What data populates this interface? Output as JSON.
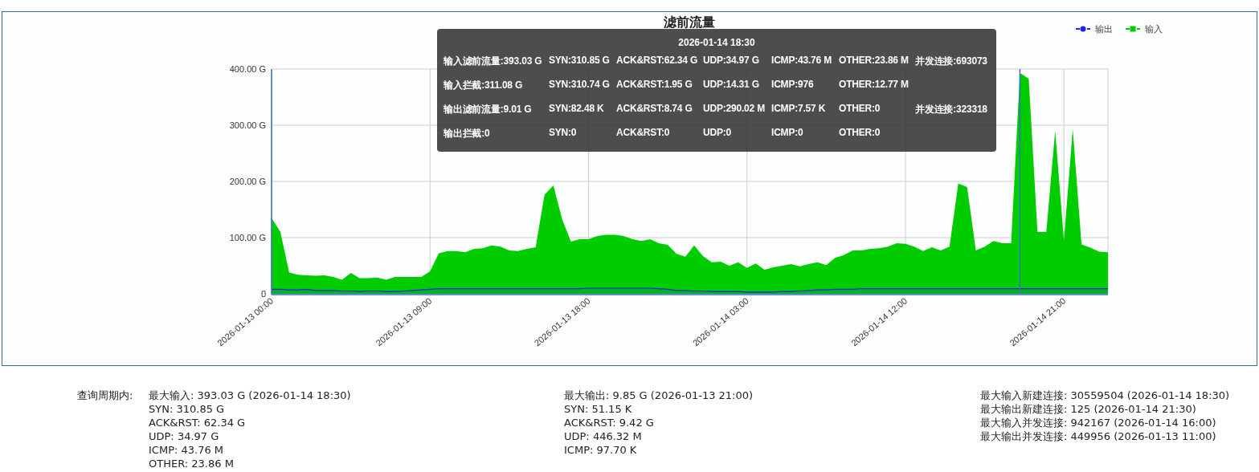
{
  "chart": {
    "chart_data": {
      "type": "area",
      "title": "滤前流量",
      "categories": [
        "2026-01-13 00:00",
        null,
        null,
        null,
        null,
        null,
        null,
        null,
        null,
        null,
        null,
        null,
        null,
        null,
        null,
        null,
        null,
        null,
        "2026-01-13 09:00",
        null,
        null,
        null,
        null,
        null,
        null,
        null,
        null,
        null,
        null,
        null,
        null,
        null,
        null,
        null,
        null,
        null,
        "2026-01-13 18:00",
        null,
        null,
        null,
        null,
        null,
        null,
        null,
        null,
        null,
        null,
        null,
        null,
        null,
        null,
        null,
        null,
        null,
        "2026-01-14 03:00",
        null,
        null,
        null,
        null,
        null,
        null,
        null,
        null,
        null,
        null,
        null,
        null,
        null,
        null,
        null,
        null,
        null,
        "2026-01-14 12:00",
        null,
        null,
        null,
        null,
        null,
        null,
        null,
        null,
        null,
        null,
        null,
        null,
        null,
        null,
        null,
        null,
        null,
        "2026-01-14 21:00",
        null,
        null,
        null,
        null,
        null
      ],
      "grid": true,
      "series": [
        {
          "name": "输出",
          "color": "#2222ee",
          "values": [
            8,
            8,
            7,
            7,
            8,
            6,
            6,
            6,
            5,
            5,
            4,
            5,
            5,
            4,
            4,
            5,
            6,
            7,
            8,
            9,
            9,
            9,
            9,
            9,
            9,
            9,
            9,
            9,
            9,
            9,
            9,
            9,
            9,
            9,
            9,
            9,
            10,
            10,
            10,
            10,
            10,
            10,
            10,
            10,
            9,
            8,
            6,
            6,
            5,
            5,
            4,
            4,
            4,
            4,
            3,
            3,
            3,
            3,
            4,
            4,
            5,
            6,
            7,
            7,
            8,
            8,
            8,
            9,
            9,
            9,
            9,
            9,
            9,
            9,
            9,
            9,
            9,
            9,
            9,
            9,
            9,
            9,
            9,
            9,
            9,
            9,
            9,
            9,
            9,
            9,
            9,
            9,
            9,
            9,
            9,
            9
          ]
        },
        {
          "name": "输入",
          "color": "#00cc00",
          "values": [
            135,
            110,
            38,
            34,
            33,
            32,
            33,
            30,
            25,
            37,
            28,
            28,
            29,
            25,
            30,
            30,
            30,
            30,
            40,
            72,
            76,
            76,
            74,
            80,
            81,
            86,
            84,
            77,
            76,
            80,
            83,
            176,
            193,
            133,
            93,
            97,
            97,
            103,
            105,
            105,
            103,
            97,
            94,
            97,
            90,
            87,
            71,
            66,
            86,
            67,
            56,
            57,
            50,
            56,
            46,
            54,
            43,
            47,
            50,
            53,
            49,
            53,
            56,
            51,
            64,
            69,
            77,
            77,
            80,
            81,
            84,
            90,
            89,
            84,
            76,
            83,
            77,
            84,
            196,
            190,
            77,
            84,
            94,
            90,
            90,
            393,
            383,
            110,
            110,
            290,
            95,
            293,
            88,
            82,
            75,
            74
          ]
        }
      ],
      "ylim": [
        0,
        400
      ],
      "yticks": [
        {
          "value": 0,
          "label": "0"
        },
        {
          "value": 100,
          "label": "100.00 G"
        },
        {
          "value": 200,
          "label": "200.00 G"
        },
        {
          "value": 300,
          "label": "300.00 G"
        },
        {
          "value": 400,
          "label": "400.00 G"
        }
      ],
      "legend": true
    },
    "tooltip": {
      "title": "2026-01-14 18:30",
      "rows": [
        [
          "输入滤前流量:393.03 G",
          "SYN:310.85 G",
          "ACK&RST:62.34 G",
          "UDP:34.97 G",
          "ICMP:43.76 M",
          "OTHER:23.86 M",
          "并发连接:693073"
        ],
        [
          "输入拦截:311.08 G",
          "SYN:310.74 G",
          "ACK&RST:1.95 G",
          "UDP:14.31 G",
          "ICMP:976",
          "OTHER:12.77 M"
        ],
        [
          "输出滤前流量:9.01 G",
          "SYN:82.48 K",
          "ACK&RST:8.74 G",
          "UDP:290.02 M",
          "ICMP:7.57 K",
          "OTHER:0",
          "并发连接:323318"
        ],
        [
          "输出拦截:0",
          "SYN:0",
          "ACK&RST:0",
          "UDP:0",
          "ICMP:0",
          "OTHER:0"
        ]
      ]
    }
  },
  "summary": {
    "label": "查询周期内:",
    "columns": [
      [
        "最大输入: 393.03 G (2026-01-14 18:30)",
        "SYN: 310.85 G",
        "ACK&RST: 62.34 G",
        "UDP: 34.97 G",
        "ICMP: 43.76 M",
        "OTHER: 23.86 M"
      ],
      [
        "最大输出: 9.85 G (2026-01-13 21:00)",
        "SYN: 51.15 K",
        "ACK&RST: 9.42 G",
        "UDP: 446.32 M",
        "ICMP: 97.70 K"
      ],
      [
        "最大输入新建连接: 30559504 (2026-01-14 18:30)",
        "最大输出新建连接: 125 (2026-01-14 21:30)",
        "最大输入并发连接: 942167 (2026-01-14 16:00)",
        "最大输出并发连接: 449956 (2026-01-13 11:00)"
      ]
    ]
  }
}
